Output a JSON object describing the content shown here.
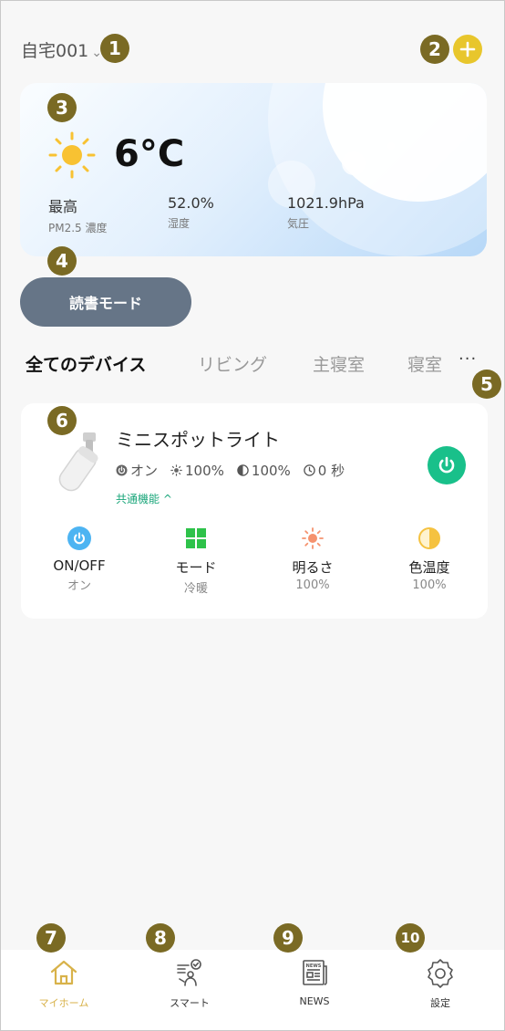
{
  "header": {
    "home_title": "自宅001",
    "home_caret": "⌄"
  },
  "weather": {
    "icon": "sun-icon",
    "temperature": "6°C",
    "stats": [
      {
        "value": "最高",
        "label": "PM2.5 濃度"
      },
      {
        "value": "52.0%",
        "label": "湿度"
      },
      {
        "value": "1021.9hPa",
        "label": "気圧"
      }
    ]
  },
  "scene": {
    "label": "読書モード"
  },
  "tabs": [
    "全てのデバイス",
    "リビング",
    "主寝室",
    "寝室"
  ],
  "more_label": "···",
  "device": {
    "name": "ミニスポットライト",
    "status": {
      "power": "オン",
      "brightness": "100%",
      "color_temp": "100%",
      "timer": "0 秒"
    },
    "common_label": "共通機能 ^",
    "features": [
      {
        "icon": "power-icon",
        "title": "ON/OFF",
        "sub": "オン",
        "color": "#4db4f2"
      },
      {
        "icon": "grid-icon",
        "title": "モード",
        "sub": "冷暖",
        "color": "#2ec24a"
      },
      {
        "icon": "brightness-icon",
        "title": "明るさ",
        "sub": "100%",
        "color": "#f5926e"
      },
      {
        "icon": "half-circle-icon",
        "title": "色温度",
        "sub": "100%",
        "color": "#f5c240"
      }
    ]
  },
  "bottom_nav": [
    {
      "icon": "home-icon",
      "label": "マイホーム",
      "active": true
    },
    {
      "icon": "smart-icon",
      "label": "スマート",
      "active": false
    },
    {
      "icon": "news-icon",
      "label": "NEWS",
      "active": false
    },
    {
      "icon": "gear-icon",
      "label": "設定",
      "active": false
    }
  ],
  "badges": [
    "1",
    "2",
    "3",
    "4",
    "5",
    "6",
    "7",
    "8",
    "9",
    "10"
  ],
  "colors": {
    "accent": "#e8c62c",
    "badge": "#7a6a24",
    "power_green": "#19c08a",
    "scene_button": "#667587",
    "nav_active": "#d8b24a"
  }
}
